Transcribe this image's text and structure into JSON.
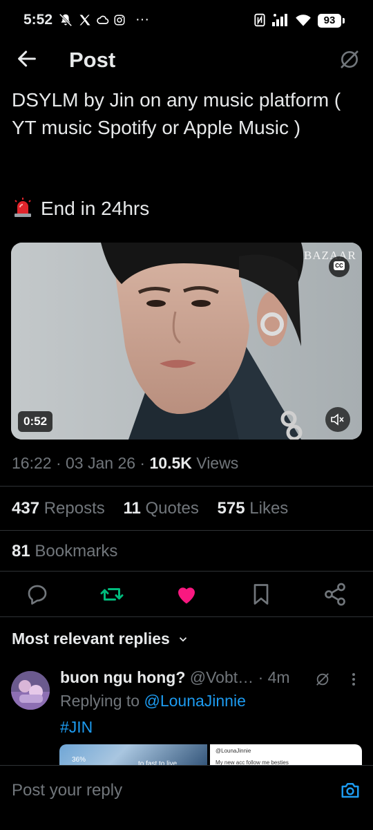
{
  "status_bar": {
    "time": "5:52",
    "battery": "93",
    "more": "···"
  },
  "header": {
    "title": "Post"
  },
  "post": {
    "text": "DSYLM by Jin on any music platform ( YT music Spotify or Apple Music )",
    "alert_text": "End in 24hrs",
    "alert_emoji": "🚨",
    "video": {
      "duration": "0:52",
      "watermark": "BAZAAR",
      "cc_label": "CC"
    },
    "meta": {
      "time": "16:22",
      "date": "03 Jan 26",
      "views_count": "10.5K",
      "views_label": "Views"
    },
    "stats": {
      "reposts_count": "437",
      "reposts_label": "Reposts",
      "quotes_count": "11",
      "quotes_label": "Quotes",
      "likes_count": "575",
      "likes_label": "Likes",
      "bookmarks_count": "81",
      "bookmarks_label": "Bookmarks"
    },
    "actions": [
      "reply-icon",
      "repost-icon",
      "like-icon",
      "bookmark-icon",
      "share-icon"
    ]
  },
  "replies": {
    "sort_label": "Most relevant replies",
    "items": [
      {
        "name": "buon ngu hong?",
        "handle": "@Vobt…",
        "time": "· 4m",
        "replying_prefix": "Replying to",
        "replying_to": "@LounaJinnie",
        "text": "#JIN",
        "image_text_1": "36%",
        "image_text_2": "to fast to live",
        "image_text_3": "@LounaJinnie",
        "image_text_4": "My new acc follow me besties"
      }
    ]
  },
  "composer": {
    "placeholder": "Post your reply"
  },
  "colors": {
    "background": "#000000",
    "text": "#e7e9ea",
    "muted": "#71767b",
    "accent": "#1d9bf0",
    "repost": "#00ba7c",
    "like": "#f91880"
  }
}
